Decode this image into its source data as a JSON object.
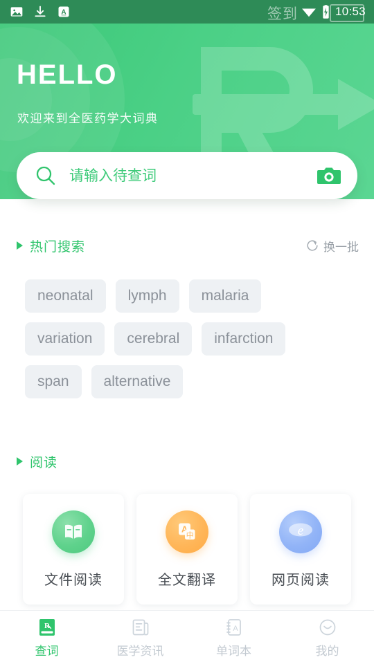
{
  "status_bar": {
    "icons": [
      "image-icon",
      "download-icon",
      "app-a-icon",
      "wifi-icon",
      "battery-charging-icon"
    ],
    "time": "10:53",
    "overlay_label": "签到"
  },
  "header": {
    "title": "HELLO",
    "subtitle": "欢迎来到全医药学大词典",
    "watermark": "rx-arrow-watermark",
    "bg_color": "#4BD086"
  },
  "search": {
    "placeholder": "请输入待查词",
    "value": "",
    "search_icon": "search-icon",
    "camera_icon": "camera-icon",
    "accent_color": "#3ECB7A"
  },
  "hot_search": {
    "title": "热门搜索",
    "refresh_label": "换一批",
    "refresh_icon": "refresh-icon",
    "tags": [
      "neonatal",
      "lymph",
      "malaria",
      "variation",
      "cerebral",
      "infarction",
      "span",
      "alternative"
    ]
  },
  "reading": {
    "title": "阅读",
    "cards": [
      {
        "label": "文件阅读",
        "icon": "open-book-icon",
        "color": "#4ec97f"
      },
      {
        "label": "全文翻译",
        "icon": "translate-icon",
        "color": "#ffab45"
      },
      {
        "label": "网页阅读",
        "icon": "browser-e-icon",
        "color": "#82a8f5"
      }
    ]
  },
  "bottom_nav": {
    "active_index": 0,
    "active_color": "#2FC46C",
    "inactive_color": "#c3cad1",
    "items": [
      {
        "label": "查词",
        "icon": "rx-book-icon"
      },
      {
        "label": "医学资讯",
        "icon": "news-icon"
      },
      {
        "label": "单词本",
        "icon": "wordbook-icon"
      },
      {
        "label": "我的",
        "icon": "profile-smiley-icon"
      }
    ]
  }
}
